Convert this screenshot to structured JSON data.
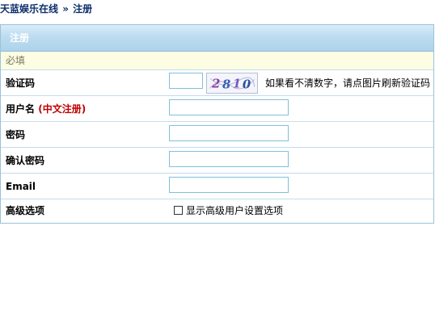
{
  "breadcrumb": {
    "site": "天蓝娱乐在线",
    "separator": "»",
    "current": "注册"
  },
  "panel": {
    "title": "注册",
    "required_note": "必填"
  },
  "form": {
    "captcha": {
      "label": "验证码",
      "value": "",
      "image_text": "2810",
      "hint": "如果看不清数字，请点图片刷新验证码"
    },
    "username": {
      "label": "用户名",
      "hint": "(中文注册)",
      "value": ""
    },
    "password": {
      "label": "密码",
      "value": ""
    },
    "confirm_password": {
      "label": "确认密码",
      "value": ""
    },
    "email": {
      "label": "Email",
      "value": ""
    },
    "advanced": {
      "label": "高级选项",
      "checkbox_label": "显示高级用户设置选项",
      "checked": false
    }
  },
  "colors": {
    "breadcrumb": "#0d2f6b",
    "header_gradient_top": "#d9ecf8",
    "header_gradient_bottom": "#aed3ea",
    "required_bg": "#fdfde4",
    "label_hint": "#c00000",
    "input_border": "#7fc1d9"
  }
}
